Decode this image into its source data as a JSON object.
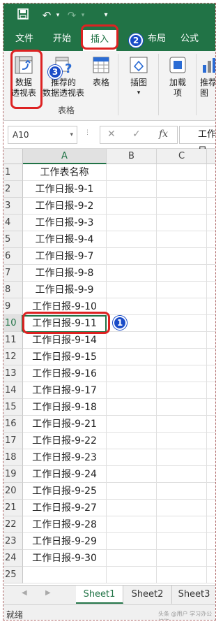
{
  "ribbon_tabs": [
    {
      "label": "文件"
    },
    {
      "label": "开始"
    },
    {
      "label": "插入"
    },
    {
      "label": "布局"
    },
    {
      "label": "公式"
    }
  ],
  "ribbon": {
    "pivot_table": "数据\n透视表",
    "pivot_table_l1": "数据",
    "pivot_table_l2": "透视表",
    "recommended_l1": "推荐的",
    "recommended_l2": "数据透视表",
    "table": "表格",
    "group_label": "表格",
    "illustrations": "插图",
    "addins_l1": "加载",
    "addins_l2": "项",
    "recommended_charts_l1": "推荐",
    "recommended_charts_l2": "图"
  },
  "name_box": "A10",
  "formula": "工作日",
  "columns": [
    "A",
    "B",
    "C"
  ],
  "rows": [
    {
      "n": "1",
      "a": "工作表名称"
    },
    {
      "n": "2",
      "a": "工作日报-9-1"
    },
    {
      "n": "3",
      "a": "工作日报-9-2"
    },
    {
      "n": "4",
      "a": "工作日报-9-3"
    },
    {
      "n": "5",
      "a": "工作日报-9-4"
    },
    {
      "n": "6",
      "a": "工作日报-9-7"
    },
    {
      "n": "7",
      "a": "工作日报-9-8"
    },
    {
      "n": "8",
      "a": "工作日报-9-9"
    },
    {
      "n": "9",
      "a": "工作日报-9-10"
    },
    {
      "n": "10",
      "a": "工作日报-9-11"
    },
    {
      "n": "11",
      "a": "工作日报-9-14"
    },
    {
      "n": "12",
      "a": "工作日报-9-15"
    },
    {
      "n": "13",
      "a": "工作日报-9-16"
    },
    {
      "n": "14",
      "a": "工作日报-9-17"
    },
    {
      "n": "15",
      "a": "工作日报-9-18"
    },
    {
      "n": "16",
      "a": "工作日报-9-21"
    },
    {
      "n": "17",
      "a": "工作日报-9-22"
    },
    {
      "n": "18",
      "a": "工作日报-9-23"
    },
    {
      "n": "19",
      "a": "工作日报-9-24"
    },
    {
      "n": "20",
      "a": "工作日报-9-25"
    },
    {
      "n": "21",
      "a": "工作日报-9-27"
    },
    {
      "n": "22",
      "a": "工作日报-9-28"
    },
    {
      "n": "23",
      "a": "工作日报-9-29"
    },
    {
      "n": "24",
      "a": "工作日报-9-30"
    },
    {
      "n": "25",
      "a": ""
    }
  ],
  "sheets": [
    "Sheet1",
    "Sheet2",
    "Sheet3"
  ],
  "status": "就绪",
  "watermark": "头条 @用户 学习办公技能",
  "callouts": {
    "one": "1",
    "two": "2",
    "three": "3"
  },
  "colors": {
    "accent": "#217346",
    "highlight": "#dd2222",
    "badge": "#1a4cc8"
  }
}
